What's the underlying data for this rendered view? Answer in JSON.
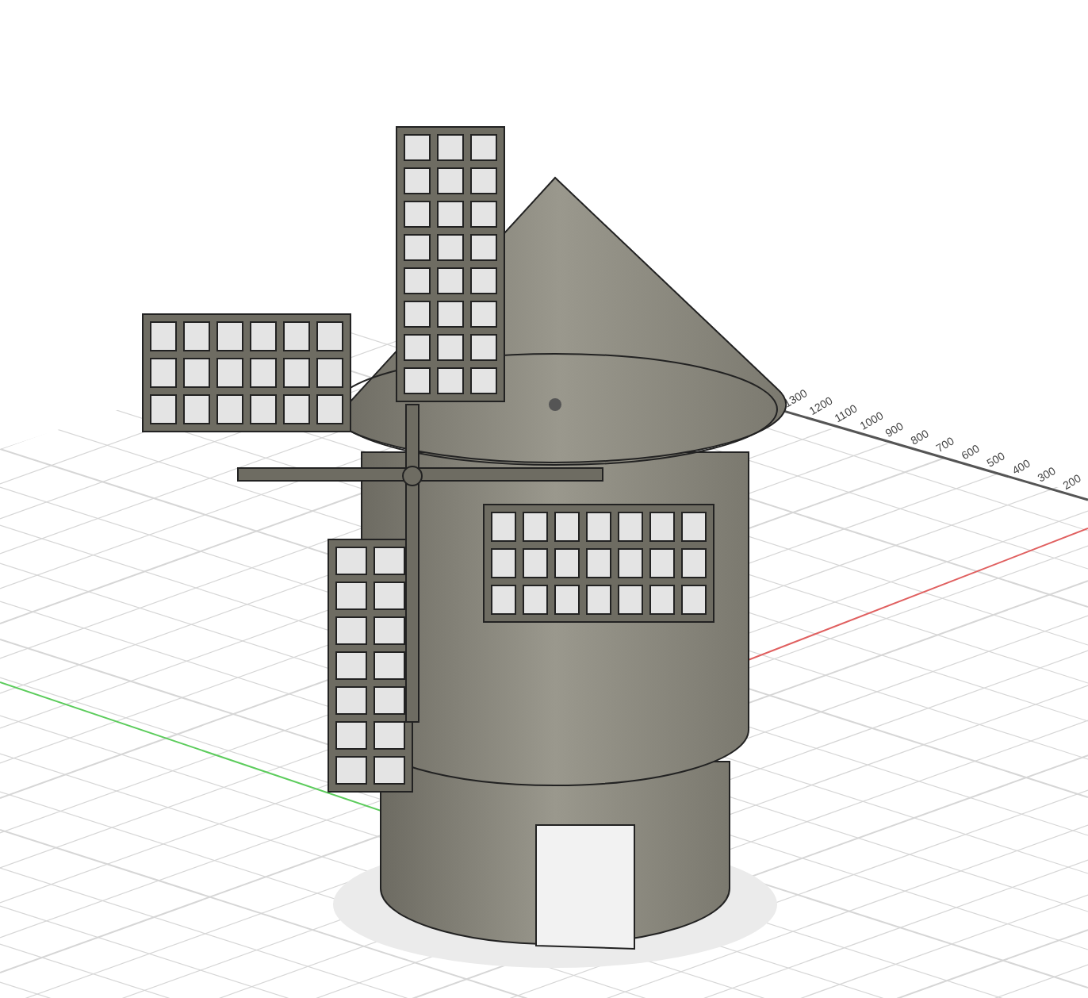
{
  "viewport": {
    "ruler_labels": [
      "1300",
      "1200",
      "1100",
      "1000",
      "900",
      "800",
      "700",
      "600",
      "500",
      "400",
      "300",
      "200"
    ]
  }
}
